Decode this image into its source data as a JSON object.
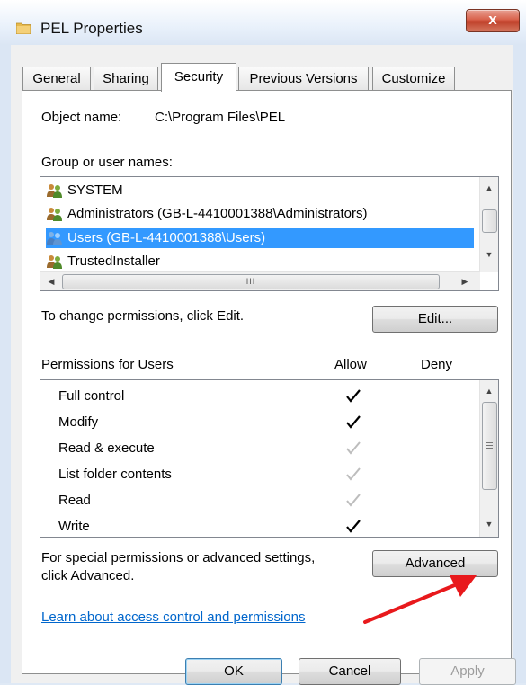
{
  "window": {
    "title": "PEL Properties",
    "close_label": "x"
  },
  "tabs": [
    {
      "label": "General"
    },
    {
      "label": "Sharing"
    },
    {
      "label": "Security",
      "active": true
    },
    {
      "label": "Previous Versions"
    },
    {
      "label": "Customize"
    }
  ],
  "security": {
    "object_name_label": "Object name:",
    "object_name_value": "C:\\Program Files\\PEL",
    "group_label": "Group or user names:",
    "users": [
      {
        "name": "SYSTEM",
        "selected": false
      },
      {
        "name": "Administrators (GB-L-4410001388\\Administrators)",
        "selected": false
      },
      {
        "name": "Users (GB-L-4410001388\\Users)",
        "selected": true
      },
      {
        "name": "TrustedInstaller",
        "selected": false
      }
    ],
    "scroll_grip": "III",
    "change_text": "To change permissions, click Edit.",
    "edit_button": "Edit...",
    "permissions_label": "Permissions for Users",
    "allow_header": "Allow",
    "deny_header": "Deny",
    "permissions": [
      {
        "name": "Full control",
        "allow": "explicit"
      },
      {
        "name": "Modify",
        "allow": "explicit"
      },
      {
        "name": "Read & execute",
        "allow": "inherited"
      },
      {
        "name": "List folder contents",
        "allow": "inherited"
      },
      {
        "name": "Read",
        "allow": "inherited"
      },
      {
        "name": "Write",
        "allow": "explicit"
      }
    ],
    "special_text_line1": "For special permissions or advanced settings,",
    "special_text_line2": "click Advanced.",
    "advanced_button": "Advanced",
    "learn_link": "Learn about access control and permissions"
  },
  "footer": {
    "ok": "OK",
    "cancel": "Cancel",
    "apply": "Apply"
  },
  "colors": {
    "selection": "#3399ff",
    "link": "#0066cc",
    "arrow": "#e8191c",
    "check_explicit": "#000000",
    "check_inherited": "#bdbdbd"
  }
}
